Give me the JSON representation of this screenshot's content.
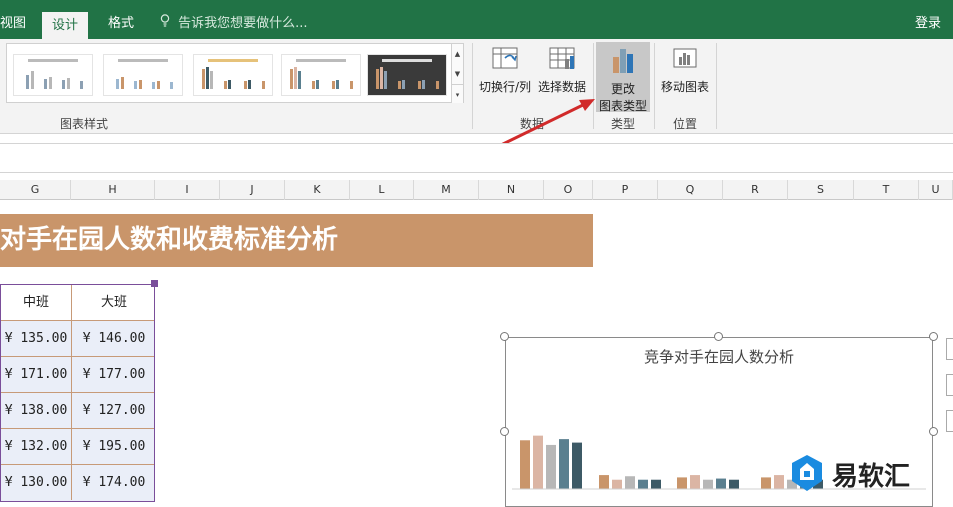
{
  "tabs": [
    {
      "label": "视图"
    },
    {
      "label": "设计"
    },
    {
      "label": "格式"
    }
  ],
  "tellme": "告诉我您想要做什么...",
  "login": "登录",
  "ribbon": {
    "chart_styles_label": "图表样式",
    "switch_label": "切换行/列",
    "select_data_label": "选择数据",
    "data_group_label": "数据",
    "change_type_line1": "更改",
    "change_type_line2": "图表类型",
    "type_group_label": "类型",
    "move_chart_label": "移动图表",
    "location_group_label": "位置"
  },
  "columns": [
    "G",
    "H",
    "I",
    "J",
    "K",
    "L",
    "M",
    "N",
    "O",
    "P",
    "Q",
    "R",
    "S",
    "T",
    "U"
  ],
  "banner": "对手在园人数和收费标准分析",
  "table": {
    "headers": [
      "中班",
      "大班"
    ],
    "rows": [
      [
        "¥ 135.00",
        "¥ 146.00"
      ],
      [
        "¥ 171.00",
        "¥ 177.00"
      ],
      [
        "¥ 138.00",
        "¥ 127.00"
      ],
      [
        "¥ 132.00",
        "¥ 195.00"
      ],
      [
        "¥ 130.00",
        "¥ 174.00"
      ]
    ]
  },
  "chart_data": {
    "type": "bar",
    "title": "竞争对手在园人数分析",
    "xlabel": "",
    "ylabel": "",
    "colors": [
      "#c9956a",
      "#dbb5a4",
      "#b7b7b7",
      "#5a7f8f",
      "#3d5a66"
    ],
    "groups": [
      [
        42,
        46,
        38,
        43,
        40
      ],
      [
        12,
        8,
        11,
        8,
        8
      ],
      [
        10,
        12,
        8,
        9,
        8
      ],
      [
        10,
        12,
        8,
        9,
        8
      ]
    ],
    "ylim": [
      0,
      50
    ]
  },
  "watermark": {
    "text": "易软汇",
    "color": "#1a8be0"
  }
}
